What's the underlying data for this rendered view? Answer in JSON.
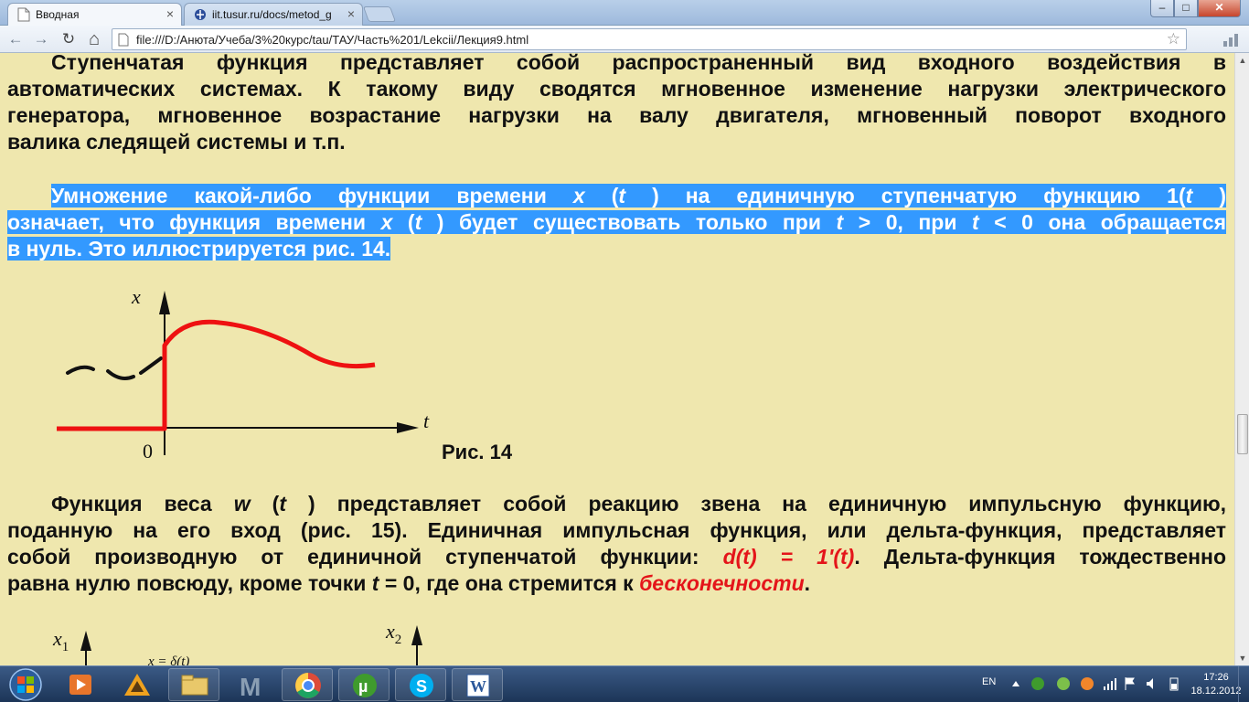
{
  "browser": {
    "tabs": [
      {
        "label": "Вводная",
        "active": true
      },
      {
        "label": "iit.tusur.ru/docs/metod_g",
        "active": false
      }
    ],
    "url": "file:///D:/Анюта/Учеба/3%20курс/tau/ТАУ/Часть%201/Lekcii/Лекция9.html",
    "close_glyph": "×",
    "min_glyph": "–",
    "max_glyph": "□",
    "win_close_glyph": "✕",
    "back_glyph": "←",
    "forward_glyph": "→",
    "reload_glyph": "↻",
    "home_glyph": "⌂",
    "star_glyph": "☆"
  },
  "page": {
    "p1": {
      "lines": [
        "Ступенчатая функция представляет собой распространенный вид входного воздействия в",
        "автоматических системах. К такому виду сводятся мгновенное изменение нагрузки электрического",
        "генератора, мгновенное возрастание нагрузки на валу двигателя, мгновенный поворот входного",
        "валика следящей системы и т.п."
      ]
    },
    "p2": {
      "l1_a": "Умножение какой-либо функции времени ",
      "l1_x": "x",
      "l1_b": " (",
      "l1_t": "t",
      "l1_c": " ) на единичную ступенчатую функцию 1(",
      "l1_t2": "t",
      "l1_d": " )",
      "l2_a": "означает, что функция времени ",
      "l2_x": "x",
      "l2_b": " (",
      "l2_t": "t",
      "l2_c": " ) будет существовать только при ",
      "l2_t3": "t",
      "l2_d": " > 0, при ",
      "l2_t4": "t",
      "l2_e": " < 0 она обращается",
      "l3": "в нуль. Это иллюстрируется рис. 14."
    },
    "fig14": {
      "x_label": "x",
      "t_label": "t",
      "origin_label": "0",
      "caption": "Рис. 14"
    },
    "p3": {
      "l1_a": "Функция веса ",
      "l1_w": "w",
      "l1_b": " (",
      "l1_t": "t",
      "l1_c": " ) представляет собой реакцию звена на единичную импульсную функцию,",
      "l2": "поданную на его вход (рис. 15). Единичная импульсная функция, или дельта-функция, представляет",
      "l3_a": "собой производную от единичной ступенчатой функции: ",
      "l3_red": "d(t) = 1'(t)",
      "l3_b": ". Дельта-функция тождественно",
      "l4_a": "равна нулю повсюду, кроме точки ",
      "l4_t": "t",
      "l4_b": " = 0, где она стремится к ",
      "l4_red": "бесконечности",
      "l4_c": "."
    },
    "fig15": {
      "x1_label": "x",
      "x1_sub": "1",
      "x2_label": "x",
      "x2_sub": "2",
      "formula_label": "x = δ(t)"
    }
  },
  "taskbar": {
    "lang": "EN",
    "time": "17:26",
    "date": "18.12.2012",
    "apps": [
      "start-orb",
      "media-player",
      "aimp",
      "file-explorer",
      "mathcad",
      "chrome",
      "utorrent",
      "skype",
      "word"
    ]
  }
}
